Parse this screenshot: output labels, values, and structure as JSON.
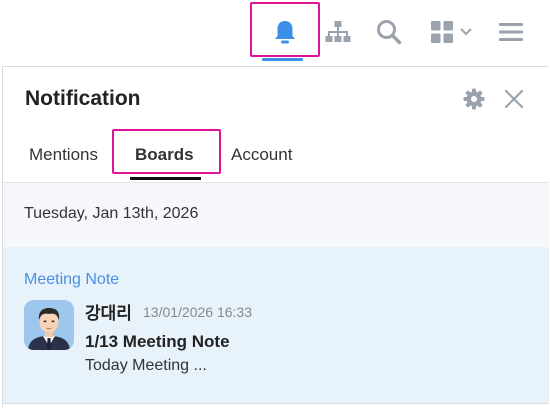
{
  "toolbar": {
    "icons": [
      "bell-icon",
      "org-chart-icon",
      "search-icon",
      "apps-grid-icon",
      "hamburger-menu-icon"
    ],
    "active_color": "#3d8ee6",
    "icon_color": "#9aa3ad",
    "highlight_color": "#e0129a"
  },
  "panel": {
    "title": "Notification",
    "tabs": [
      {
        "label": "Mentions",
        "active": false
      },
      {
        "label": "Boards",
        "active": true
      },
      {
        "label": "Account",
        "active": false
      }
    ]
  },
  "feed": {
    "date": "Tuesday, Jan 13th, 2026",
    "items": [
      {
        "category": "Meeting Note",
        "author": "강대리",
        "time": "13/01/2026 16:33",
        "subject": "1/13 Meeting Note",
        "preview": "Today Meeting ..."
      }
    ]
  }
}
